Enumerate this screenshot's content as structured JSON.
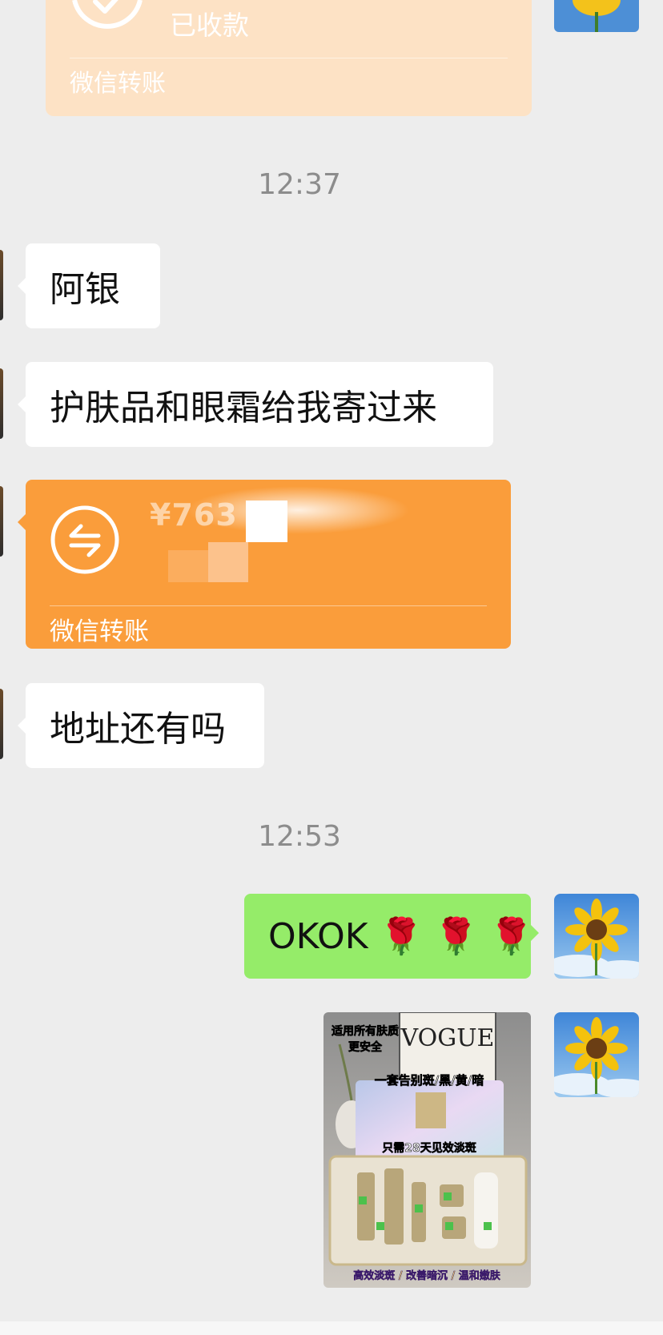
{
  "chat": {
    "top_transfer": {
      "status": "已收款",
      "label": "微信转账"
    },
    "time1": "12:37",
    "msg1": "阿银",
    "msg2": "护肤品和眼霜给我寄过来",
    "transfer": {
      "amount": "¥763",
      "label": "微信转账"
    },
    "msg3": "地址还有吗",
    "time2": "12:53",
    "my_msg": "OKOK 🌹 🌹 🌹",
    "product": {
      "line1": "适用所有肤质",
      "line2": "更安全",
      "brand": "VOGUE",
      "slogan": "一套告别斑/黑/黄/暗",
      "promise": "只需28天见效淡斑",
      "footer": "高效淡斑 / 改善暗沉 / 温和嫩肤"
    }
  },
  "colors": {
    "background": "#ededed",
    "received_card": "#fde2c5",
    "transfer_card": "#fa9d3b",
    "my_bubble": "#95ec69",
    "other_bubble": "#ffffff"
  }
}
